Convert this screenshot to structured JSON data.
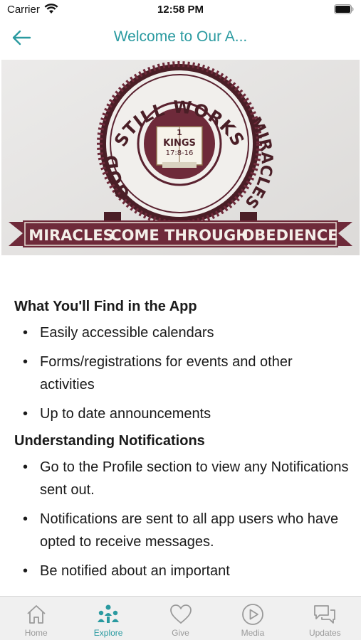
{
  "status": {
    "carrier": "Carrier",
    "time": "12:58 PM"
  },
  "nav": {
    "title": "Welcome to Our A..."
  },
  "hero": {
    "arc_top": "STILL WORKS",
    "arc_left": "GOD",
    "arc_right": "MIRACLES",
    "book_line1": "1",
    "book_line2": "KINGS",
    "book_line3": "17:8-16",
    "banner_left": "MIRACLES",
    "banner_center": "COME THROUGH",
    "banner_right": "OBEDIENCE"
  },
  "sections": [
    {
      "heading": "What You'll Find in the App",
      "items": [
        "Easily accessible calendars",
        "Forms/registrations for events and other activities",
        "Up to date announcements"
      ]
    },
    {
      "heading": "Understanding Notifications",
      "items": [
        "Go to the Profile section to view any Notifications sent out.",
        "Notifications are sent to all app users who have opted to receive messages.",
        "Be notified about an important"
      ]
    }
  ],
  "tabs": [
    {
      "label": "Home",
      "icon": "home-icon"
    },
    {
      "label": "Explore",
      "icon": "people-icon",
      "active": true
    },
    {
      "label": "Give",
      "icon": "heart-icon"
    },
    {
      "label": "Media",
      "icon": "play-icon"
    },
    {
      "label": "Updates",
      "icon": "chat-bubbles-icon"
    }
  ],
  "colors": {
    "accent": "#2a9aa0",
    "maroon": "#6e2a3a",
    "tab_inactive": "#9a9a9a"
  }
}
